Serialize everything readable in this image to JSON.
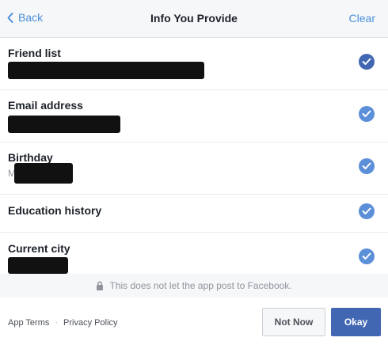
{
  "header": {
    "back_label": "Back",
    "title": "Info You Provide",
    "clear_label": "Clear"
  },
  "permissions": [
    {
      "label": "Friend list",
      "checked": true
    },
    {
      "label": "Email address",
      "checked": true
    },
    {
      "label": "Birthday",
      "checked": true,
      "partial_text": "M"
    },
    {
      "label": "Education history",
      "checked": true
    },
    {
      "label": "Current city",
      "checked": true
    }
  ],
  "note": "This does not let the app post to Facebook.",
  "footer": {
    "app_terms": "App Terms",
    "separator": "·",
    "privacy_policy": "Privacy Policy",
    "not_now_label": "Not Now",
    "okay_label": "Okay"
  },
  "colors": {
    "check_active": "#4267b2",
    "check": "#5b8fd8",
    "link": "#4a90d9",
    "primary_button": "#4267b2"
  }
}
